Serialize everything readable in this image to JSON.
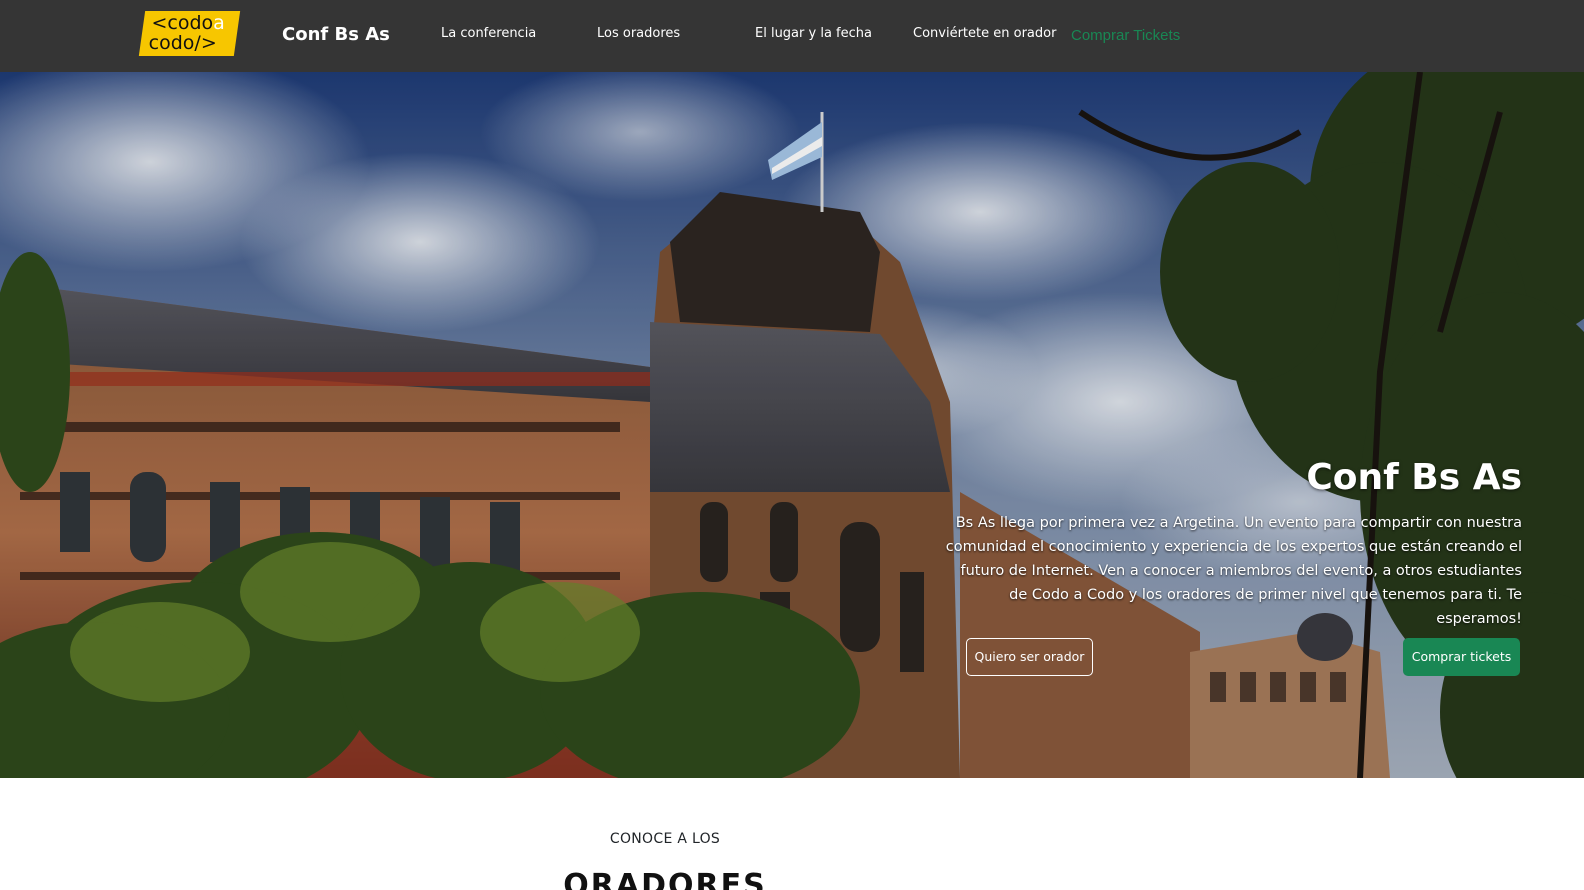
{
  "logo": {
    "line1_a": "<codo",
    "line1_b": "a",
    "line2": "codo/>"
  },
  "nav": {
    "brand": "Conf Bs As",
    "links": [
      "La conferencia",
      "Los oradores",
      "El lugar y la fecha",
      "Conviértete en orador"
    ],
    "tickets": "Comprar Tickets"
  },
  "hero": {
    "title": "Conf Bs As",
    "description": "Bs As llega por primera vez a Argetina. Un evento para compartir con nuestra comunidad el conocimiento y experiencia de los expertos que están creando el futuro de Internet. Ven a conocer a miembros del evento, a otros estudiantes de Codo a Codo y los oradores de primer nivel que tenemos para ti. Te esperamos!",
    "button_outline": "Quiero ser orador",
    "button_primary": "Comprar tickets"
  },
  "section": {
    "eyebrow": "CONOCE A LOS",
    "title": "ORADORES"
  },
  "colors": {
    "navbar": "#353535",
    "accent_green": "#198754",
    "logo_yellow": "#f7c600"
  }
}
